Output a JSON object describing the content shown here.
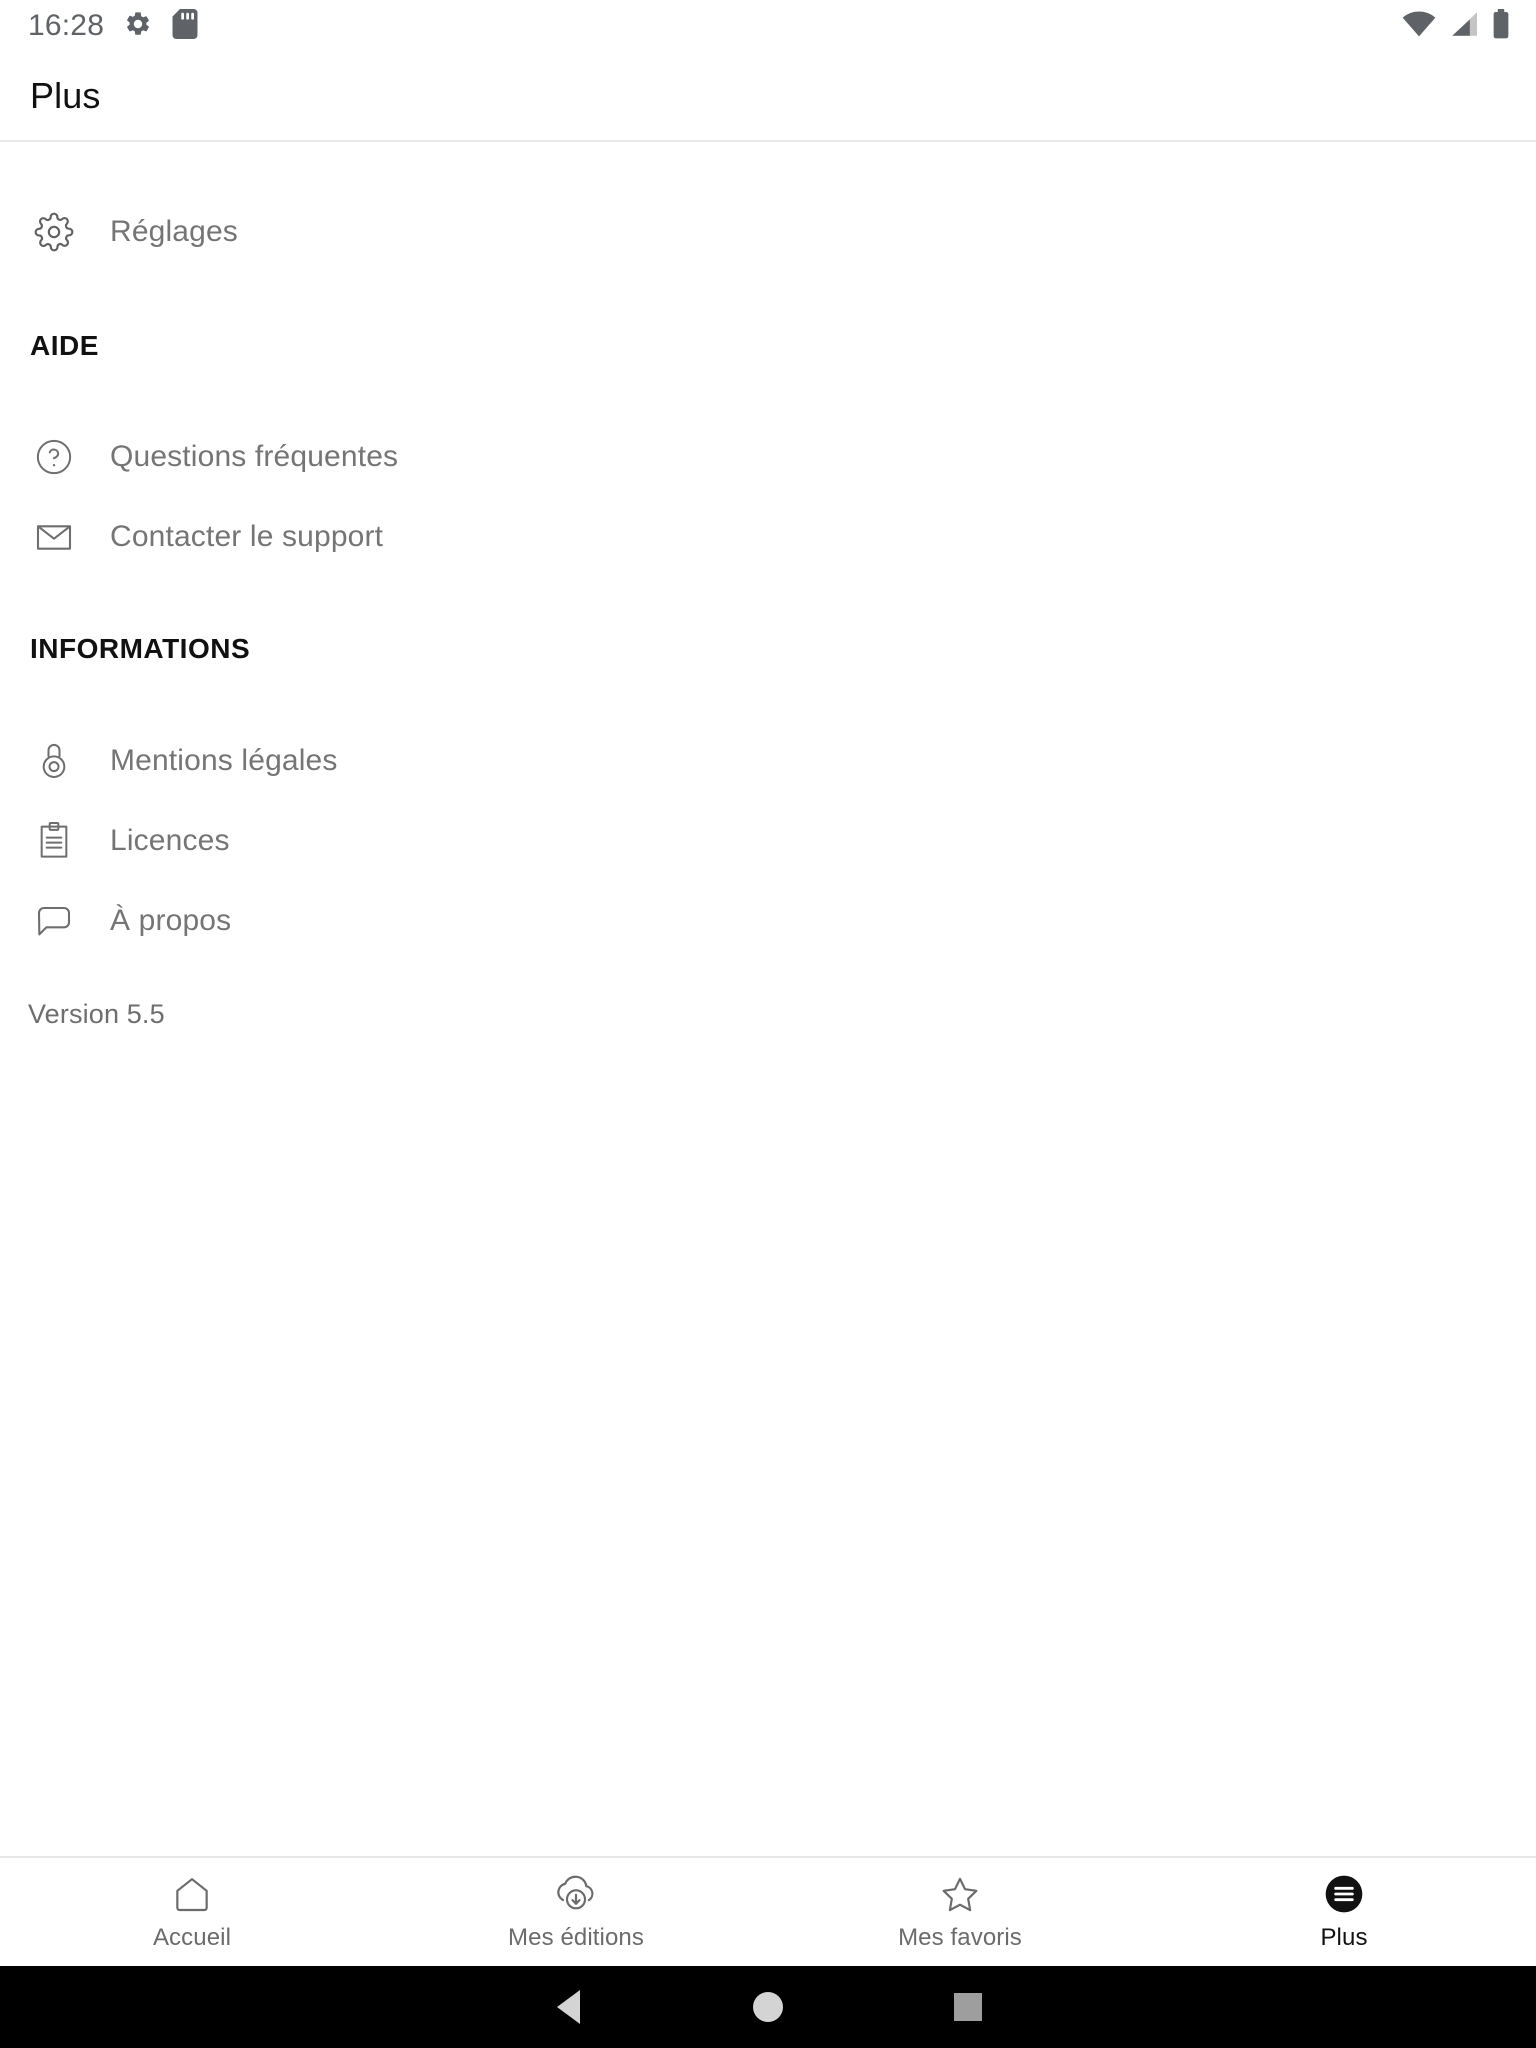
{
  "status_bar": {
    "time": "16:28",
    "left_icons": [
      "gear-icon",
      "sd-card-icon"
    ],
    "right_icons": [
      "wifi-icon",
      "cellular-signal-icon",
      "battery-icon"
    ]
  },
  "app_bar": {
    "title": "Plus"
  },
  "content": {
    "settings_item": {
      "label": "Réglages",
      "icon": "gear-icon"
    },
    "sections": [
      {
        "title": "AIDE",
        "items": [
          {
            "label": "Questions fréquentes",
            "icon": "help-circle-icon"
          },
          {
            "label": "Contacter le support",
            "icon": "envelope-icon"
          }
        ]
      },
      {
        "title": "INFORMATIONS",
        "items": [
          {
            "label": "Mentions légales",
            "icon": "padlock-icon"
          },
          {
            "label": "Licences",
            "icon": "clipboard-icon"
          },
          {
            "label": "À propos",
            "icon": "speech-bubble-icon"
          }
        ]
      }
    ],
    "version": "Version 5.5"
  },
  "bottom_nav": {
    "items": [
      {
        "label": "Accueil",
        "icon": "home-icon",
        "active": false
      },
      {
        "label": "Mes éditions",
        "icon": "download-circle-icon",
        "active": false
      },
      {
        "label": "Mes favoris",
        "icon": "star-icon",
        "active": false
      },
      {
        "label": "Plus",
        "icon": "menu-circle-filled-icon",
        "active": true
      }
    ]
  },
  "system_nav": {
    "back": "back-triangle-icon",
    "home": "home-circle-icon",
    "recents": "recents-square-icon"
  },
  "colors": {
    "text_primary": "#111111",
    "text_secondary": "#757575",
    "icon_stroke": "#616161",
    "divider": "#e8e8e8",
    "background": "#ffffff",
    "system_bar": "#000000"
  }
}
